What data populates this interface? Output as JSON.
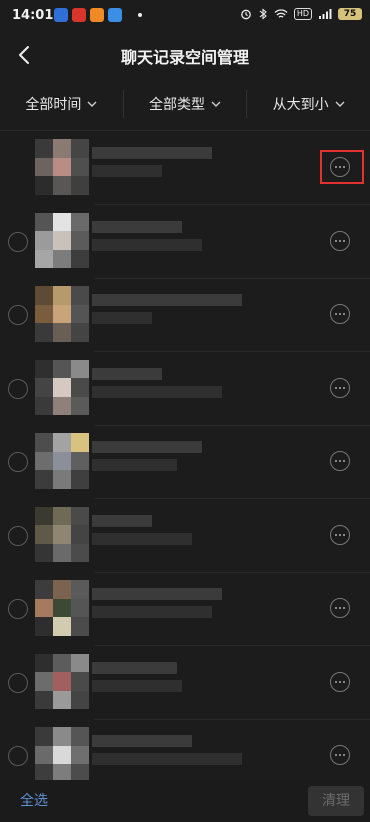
{
  "status": {
    "time": "14:01",
    "battery": "75",
    "hd": "HD",
    "signal": "5G"
  },
  "header": {
    "title": "聊天记录空间管理"
  },
  "filters": [
    {
      "label": "全部时间"
    },
    {
      "label": "全部类型"
    },
    {
      "label": "从大到小"
    }
  ],
  "rows_count": 9,
  "bottom": {
    "select_all": "全选",
    "clean": "清理"
  }
}
